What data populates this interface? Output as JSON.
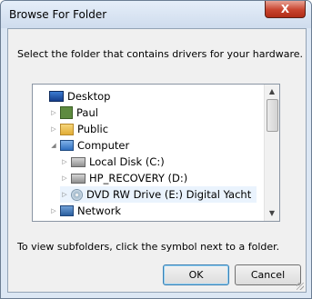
{
  "window": {
    "title": "Browse For Folder",
    "close_label": "X"
  },
  "instruction": "Select the folder that contains drivers for your hardware.",
  "tree": {
    "items": [
      {
        "label": "Desktop",
        "icon": "desktop-icon",
        "toggle": ""
      },
      {
        "label": "Paul",
        "icon": "user-folder-icon",
        "toggle": "▷"
      },
      {
        "label": "Public",
        "icon": "public-folder-icon",
        "toggle": "▷"
      },
      {
        "label": "Computer",
        "icon": "computer-icon",
        "toggle": "◢"
      },
      {
        "label": "Local Disk (C:)",
        "icon": "local-disk-icon",
        "toggle": "▷"
      },
      {
        "label": "HP_RECOVERY (D:)",
        "icon": "drive-icon",
        "toggle": "▷"
      },
      {
        "label": "DVD RW Drive (E:) Digital Yacht",
        "icon": "dvd-drive-icon",
        "toggle": "▷",
        "selected": true
      },
      {
        "label": "Network",
        "icon": "network-icon",
        "toggle": "▷"
      }
    ]
  },
  "scrollbar": {
    "up": "▲",
    "down": "▼"
  },
  "note": "To view subfolders, click the symbol next to a folder.",
  "buttons": {
    "ok": "OK",
    "cancel": "Cancel"
  }
}
